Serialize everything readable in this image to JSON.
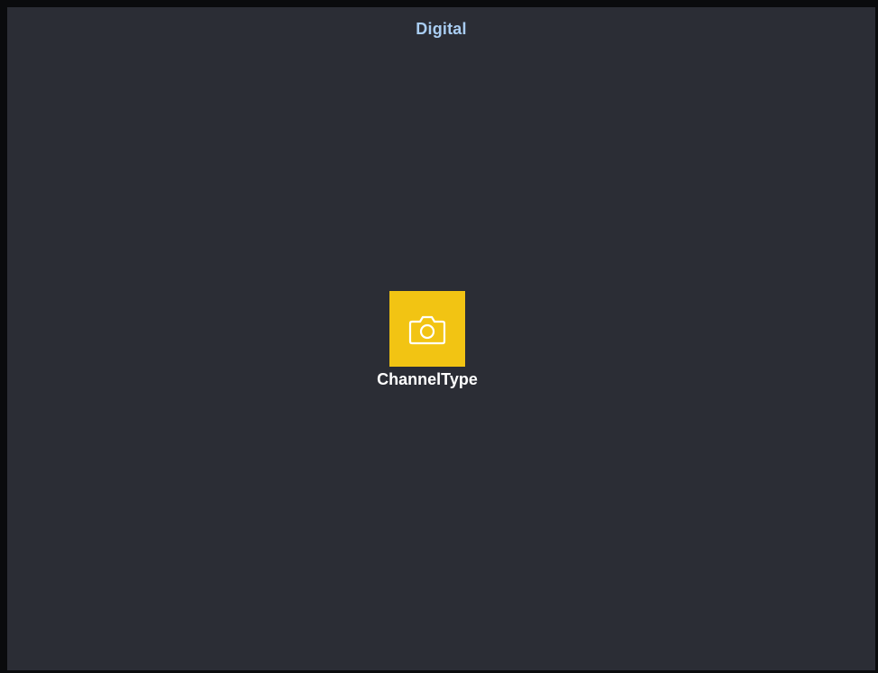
{
  "header": {
    "title": "Digital"
  },
  "channel_tile": {
    "label": "ChannelType",
    "icon": "camera-icon",
    "accent_color": "#f2c413"
  },
  "colors": {
    "background": "#2b2d35",
    "title": "#a9cdf2",
    "label": "#ffffff"
  }
}
